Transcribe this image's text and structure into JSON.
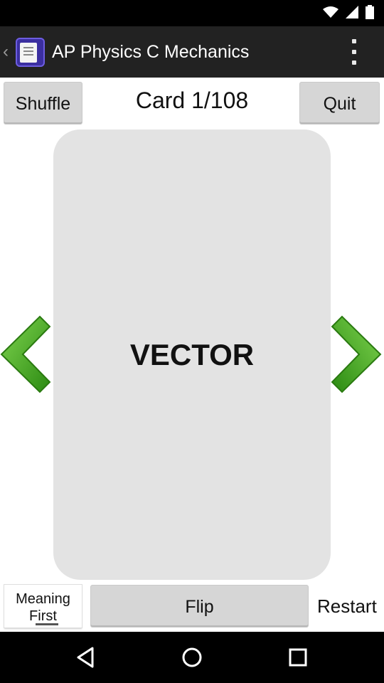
{
  "status_bar": {
    "icons": [
      "wifi-icon",
      "signal-icon",
      "battery-icon"
    ],
    "background": "#000000"
  },
  "action_bar": {
    "title": "AP Physics C Mechanics",
    "back_glyph": "‹",
    "app_icon": "flashcard-app-icon",
    "background": "#222222"
  },
  "top_controls": {
    "shuffle_label": "Shuffle",
    "card_counter": "Card 1/108",
    "quit_label": "Quit"
  },
  "card": {
    "term": "VECTOR",
    "background": "#e3e3e3"
  },
  "arrows": {
    "prev": "chevron-left-arrow-icon",
    "next": "chevron-right-arrow-icon",
    "color": "#3aa41c"
  },
  "bottom_controls": {
    "meaning_first_line1": "Meaning",
    "meaning_first_line2": "First",
    "flip_label": "Flip",
    "restart_label": "Restart"
  },
  "nav_bar": {
    "icons": [
      "back-triangle-icon",
      "home-circle-icon",
      "recents-square-icon"
    ]
  }
}
